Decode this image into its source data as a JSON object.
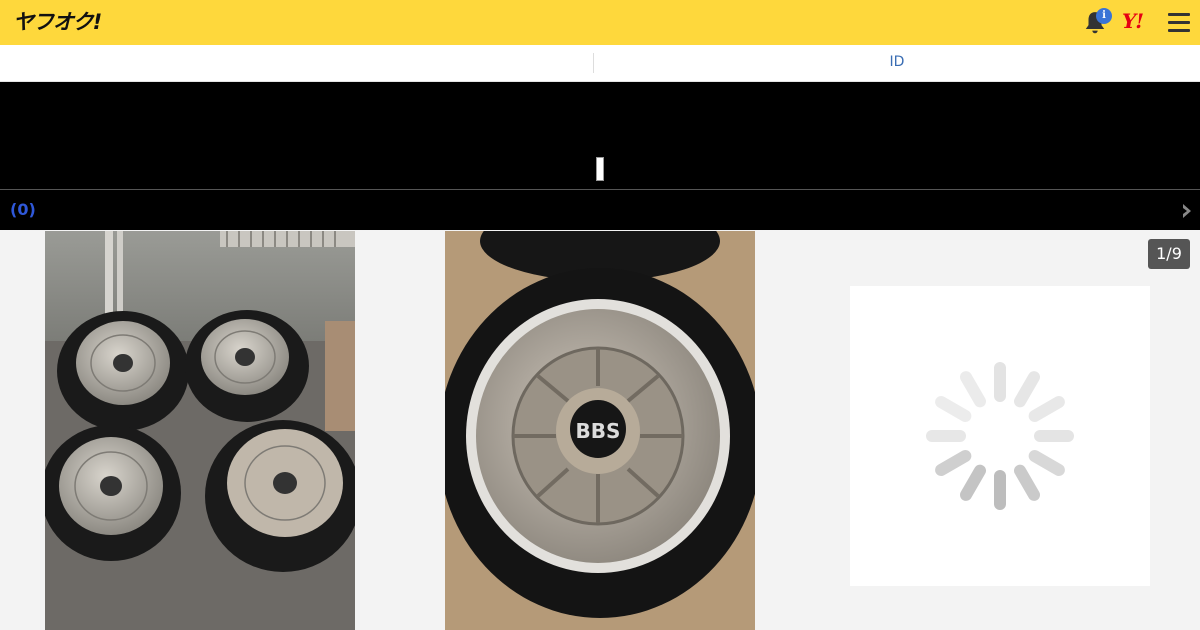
{
  "header": {
    "logo_text": "ヤフオク!",
    "notification_badge": "i",
    "yahoo_logo": "Y!",
    "brand_color": "#fed83c",
    "icons": [
      "bell-icon",
      "menu-icon"
    ]
  },
  "tabs": {
    "left_label": "",
    "right_label": "ID"
  },
  "seller": {
    "rating": "(0)"
  },
  "gallery": {
    "counter": "1/9",
    "photos": [
      "wheel-set-photo",
      "wheel-closeup-photo"
    ],
    "loading": true
  }
}
